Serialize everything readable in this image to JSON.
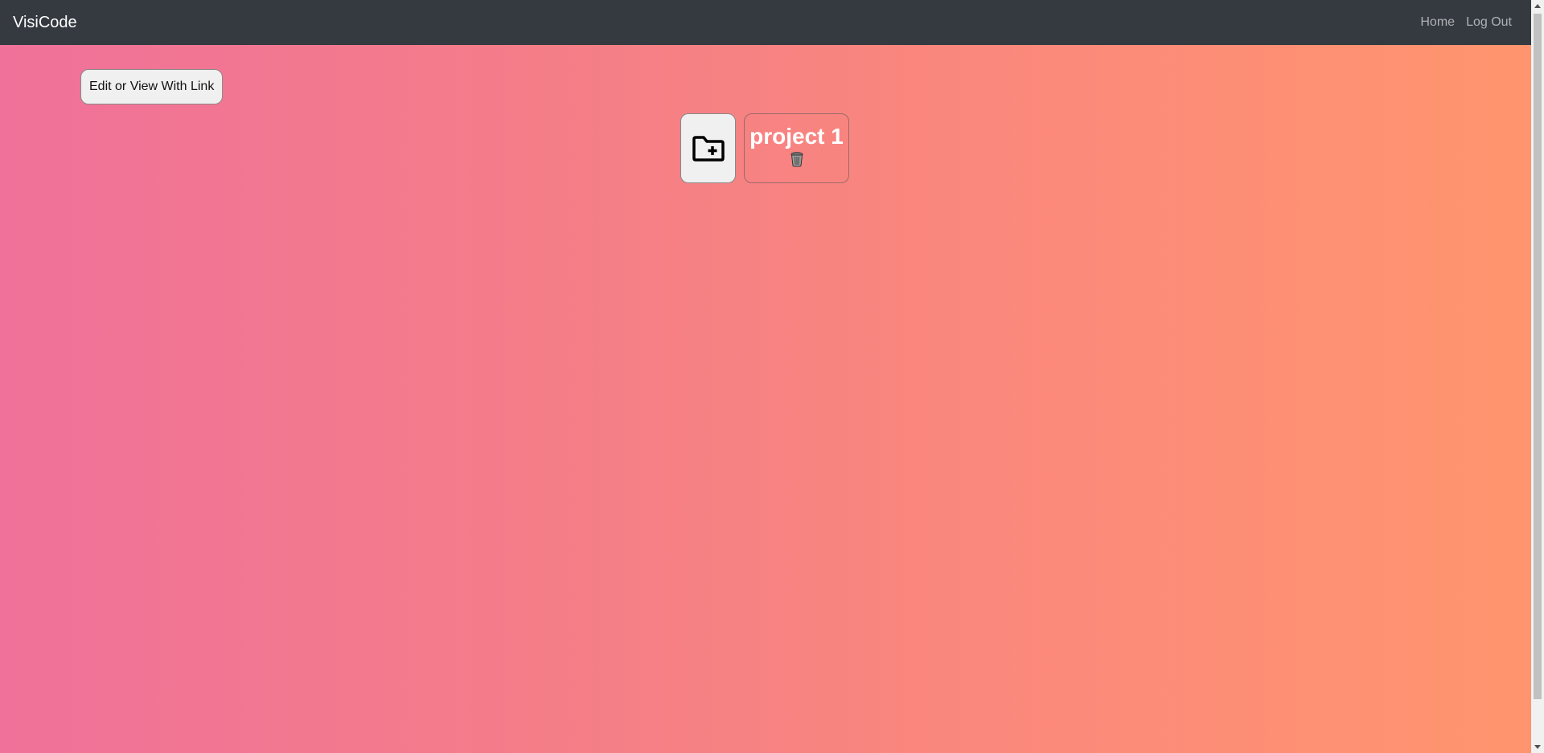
{
  "navbar": {
    "brand": "VisiCode",
    "links": [
      "Home",
      "Log Out"
    ]
  },
  "main": {
    "link_button_label": "Edit or View With Link",
    "new_project_icon": "folder-plus-icon",
    "projects": [
      {
        "name": "project 1",
        "delete_icon": "trash-icon"
      }
    ]
  },
  "colors": {
    "navbar_bg": "#343a40",
    "gradient_start": "#f0719a",
    "gradient_end": "#ff956e"
  }
}
